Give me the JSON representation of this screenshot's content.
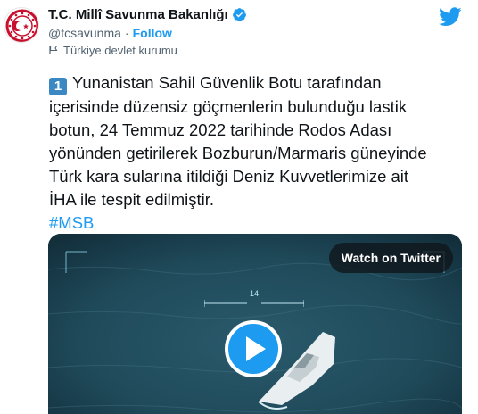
{
  "account": {
    "name": "T.C. Millî Savunma Bakanlığı",
    "handle": "@tcsavunma",
    "separator": "·",
    "follow_label": "Follow",
    "label_text": "Türkiye devlet kurumu"
  },
  "tweet": {
    "keycap": "1",
    "lines": [
      "Yunanistan Sahil Güvenlik Botu tarafından",
      "içerisinde düzensiz göçmenlerin bulunduğu lastik",
      "botun, 24 Temmuz 2022 tarihinde Rodos Adası",
      "yönünden getirilerek Bozburun/Marmaris güneyinde",
      "Türk kara sularına itildiği Deniz Kuvvetlerimize ait",
      "İHA ile tespit edilmiştir."
    ],
    "hashtag": "#MSB"
  },
  "media": {
    "watch_label": "Watch on Twitter",
    "hud_number": "14"
  },
  "icons": {
    "avatar": "ministry-seal-icon",
    "verified": "verified-badge-icon",
    "brand": "twitter-bird-icon",
    "label": "flag-icon",
    "play": "play-icon"
  },
  "colors": {
    "accent": "#1d9bf0",
    "text": "#0f1419",
    "secondary": "#536471",
    "keycap": "#3b88c3",
    "seal_red": "#c8102e"
  }
}
